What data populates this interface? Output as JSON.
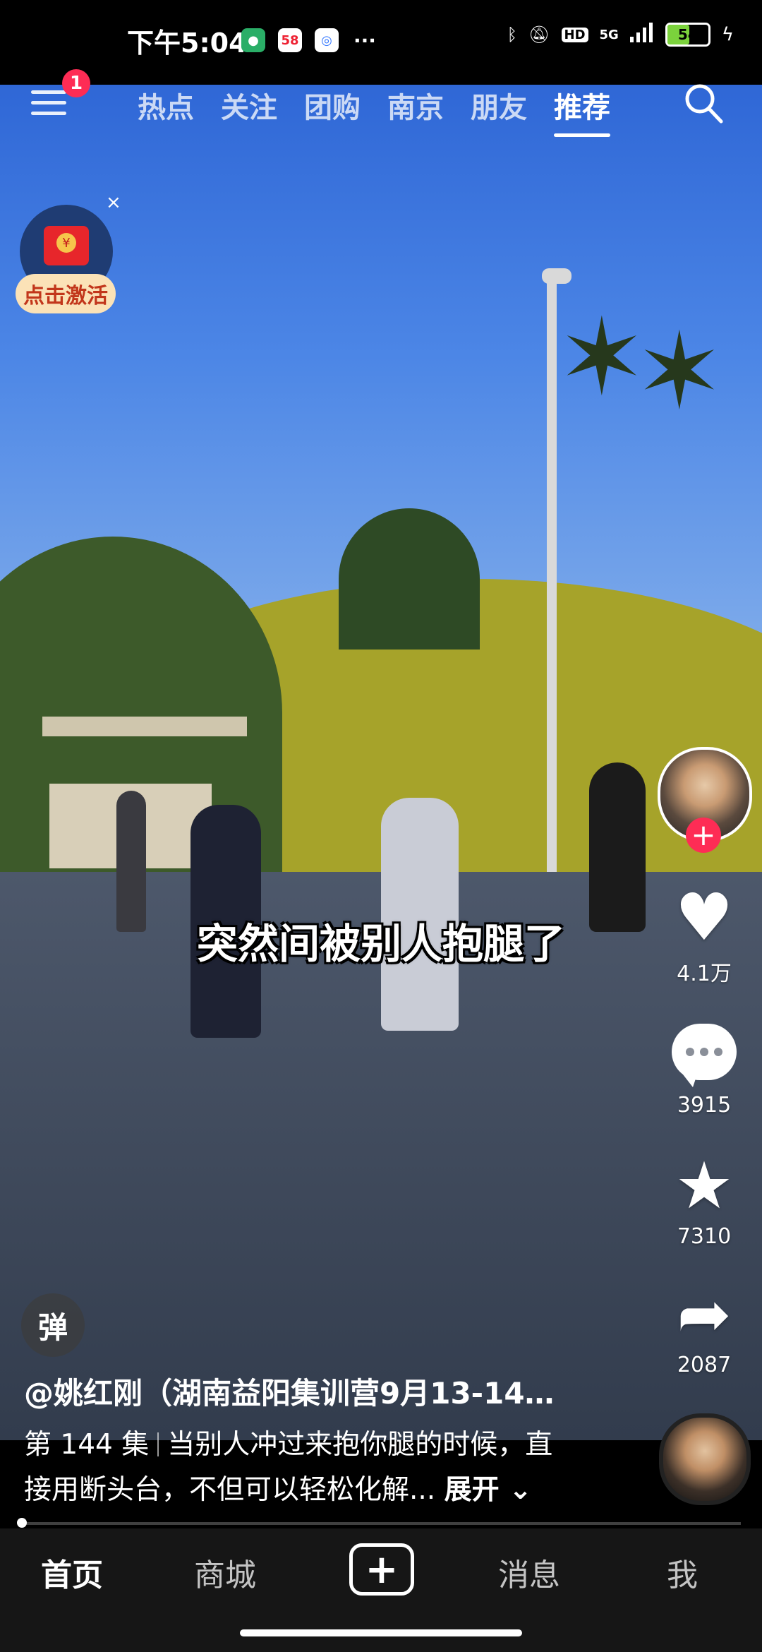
{
  "status_bar": {
    "time": "下午5:04",
    "app_icons": [
      "wechat-icon",
      "58-app-icon",
      "quark-icon"
    ],
    "more": "···",
    "network": "5G",
    "hd": "HD",
    "battery": "54"
  },
  "top_nav": {
    "menu_badge": "1",
    "tabs": [
      "热点",
      "关注",
      "团购",
      "南京",
      "朋友",
      "推荐"
    ],
    "active_tab": "推荐"
  },
  "red_packet": {
    "label": "点击激活",
    "close": "×"
  },
  "video": {
    "subtitle": "突然间被别人抱腿了"
  },
  "right_rail": {
    "likes": "4.1万",
    "comments": "3915",
    "favorites": "7310",
    "shares": "2087"
  },
  "danmu_label": "弹",
  "post": {
    "author": "@姚红刚（湖南益阳集训营9月13-14…",
    "episode": "第 144 集",
    "desc_line1": "当别人冲过来抱你腿的时候，直",
    "desc_line2": "接用断头台，不但可以轻松化解...",
    "expand": "展开"
  },
  "bottom_nav": {
    "home": "首页",
    "mall": "商城",
    "messages": "消息",
    "me": "我"
  },
  "colors": {
    "accent": "#fe2c55",
    "battery": "#7bd23c",
    "bottom_bar": "#161616"
  }
}
